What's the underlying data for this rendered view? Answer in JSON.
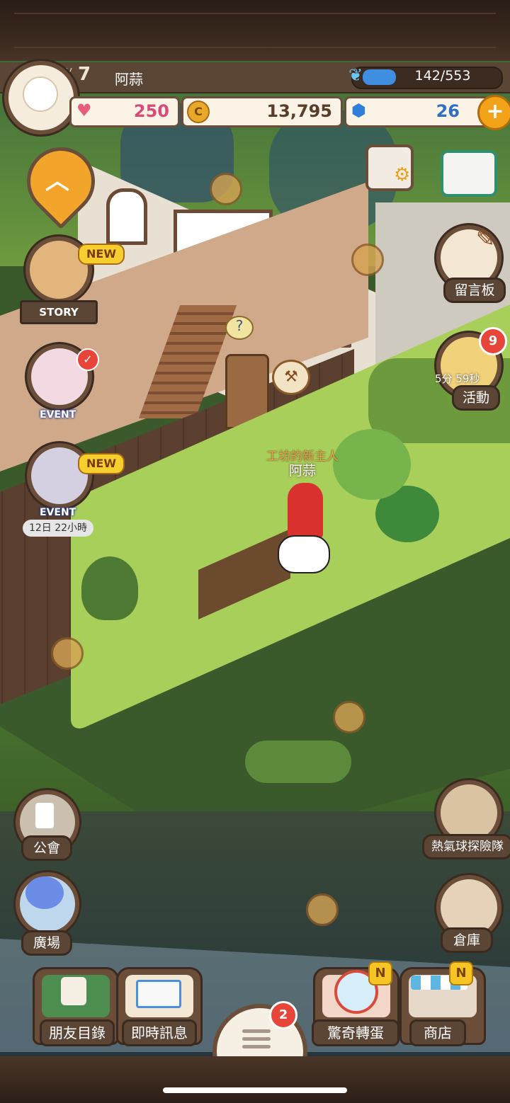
{
  "player": {
    "level_prefix": "LV",
    "level": "7",
    "name": "阿蒜"
  },
  "experience": {
    "text": "142/553",
    "current": 142,
    "max": 553
  },
  "resources": {
    "hearts": "250",
    "gold": "13,795",
    "gems": "26",
    "gem_add": "+"
  },
  "left_menu": {
    "story_tag": "NEW",
    "story_label": "STORY",
    "event1_label": "EVENT",
    "event2_tag": "NEW",
    "event2_label": "EVENT",
    "event2_timer": "12日 22小時"
  },
  "right_menu": {
    "board_label": "留言板",
    "activity_badge": "9",
    "activity_timer": "5分 59秒",
    "activity_label": "活動",
    "balloon_label": "熱氣球探險隊",
    "warehouse_label": "倉庫"
  },
  "npc": {
    "title": "工坊的新主人",
    "name": "阿蒜"
  },
  "guild_label": "公會",
  "plaza_label": "廣場",
  "bottom_bar": {
    "friends_label": "朋友目錄",
    "messages_label": "即時訊息",
    "menu_badge": "2",
    "gacha_badge": "N",
    "gacha_label": "驚奇轉蛋",
    "shop_badge": "N",
    "shop_label": "商店"
  },
  "colors": {
    "hud_brown": "#5b4535",
    "grass": "#a8cf5a",
    "floor": "#5b4030",
    "accent_yellow": "#f6cf2e"
  }
}
